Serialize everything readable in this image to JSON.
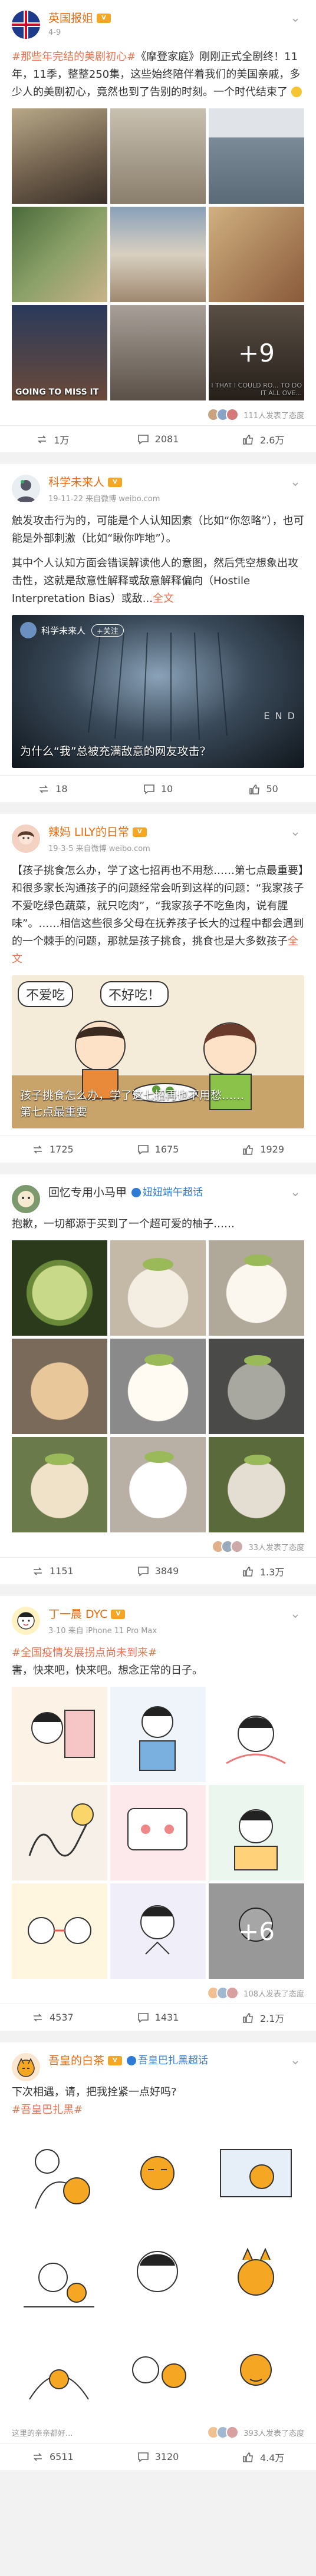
{
  "icons": {
    "more": "chevron-down-icon",
    "repost": "repost-icon",
    "comment": "comment-icon",
    "like": "like-icon"
  },
  "colors": {
    "accent": "#eb7350",
    "vip": "#f5a623",
    "link": "#2e7bd6"
  },
  "posts": [
    {
      "user": "英国报姐",
      "sub": "4-9",
      "text_tag": "#那些年完结的美剧初心#",
      "text_main": "《摩登家庭》刚刚正式全剧终！11年，11季，整整250集，这些始终陪伴着我们的美国亲戚，多少人的美剧初心，竟然也到了告别的时刻。一个时代结束了",
      "plus": "+9",
      "img_captions": [
        "GOING TO MISS IT",
        "I THAT I COULD RO... TO DO IT ALL OVE..."
      ],
      "likers": "111人发表了态度",
      "repost": "1万",
      "comment": "2081",
      "like": "2.6万"
    },
    {
      "user": "科学未来人",
      "sub": "19-11-22  来自微博 weibo.com",
      "p1": "触发攻击行为的，可能是个人认知因素（比如“你忽略”），也可能是外部刺激（比如“瞅你咋地”）。",
      "p2": "其中个人认知方面会错误解读他人的意图，然后凭空想象出攻击性，这就是敌意性解释或敌意解释偏向（Hostile Interpretation Bias）或敌...",
      "fulltext": "全文",
      "vid_user": "科学未来人",
      "vid_follow": "+关注",
      "vid_caption": "为什么“我”总被充满敌意的网友攻击？",
      "vid_end": "E N D",
      "repost": "18",
      "comment": "10",
      "like": "50"
    },
    {
      "user": "辣妈 LILY的日常",
      "sub": "19-3-5  来自微博 weibo.com",
      "text_tag": "【孩子挑食怎么办，学了这七招再也不用愁……第七点最重要】",
      "text_main": "和很多家长沟通孩子的问题经常会听到这样的问题：“我家孩子不爱吃绿色蔬菜，就只吃肉”，“我家孩子不吃鱼肉，说有腥味”。……相信这些很多父母在抚养孩子长大的过程中都会遇到的一个棘手的问题，那就是孩子挑食，挑食也是大多数孩子",
      "fulltext": "全文",
      "bubble1": "不爱吃",
      "bubble2": "不好吃！",
      "vid_caption1": "孩子挑食怎么办，学了这七招再也不用愁……",
      "vid_caption2": "第七点最重要",
      "repost": "1725",
      "comment": "1675",
      "like": "1929"
    },
    {
      "user": "回忆专用小马甲",
      "badge": "妞妞端午超话",
      "sub": "",
      "text_main": "抱歉，一切都源于买到了一个超可爱的柚子……",
      "likers": "33人发表了态度",
      "repost": "1151",
      "comment": "3849",
      "like": "1.3万"
    },
    {
      "user": "丁一晨 DYC",
      "sub": "3-10  来自 iPhone 11 Pro Max",
      "text_tag": "#全国疫情发展拐点尚未到来#",
      "text_main": "害，快来吧，快来吧。想念正常的日子。",
      "plus": "+6",
      "likers": "108人发表了态度",
      "repost": "4537",
      "comment": "1431",
      "like": "2.1万"
    },
    {
      "user": "吾皇的白茶",
      "badge": "吾皇巴扎黑超话",
      "sub": "",
      "text_main": "下次相遇，请，把我拴紧一点好吗?",
      "text_tag": "#吾皇巴扎黑#",
      "likers_left": "这里的亲亲都好...",
      "likers": "393人发表了态度",
      "repost": "6511",
      "comment": "3120",
      "like": "4.4万"
    }
  ]
}
